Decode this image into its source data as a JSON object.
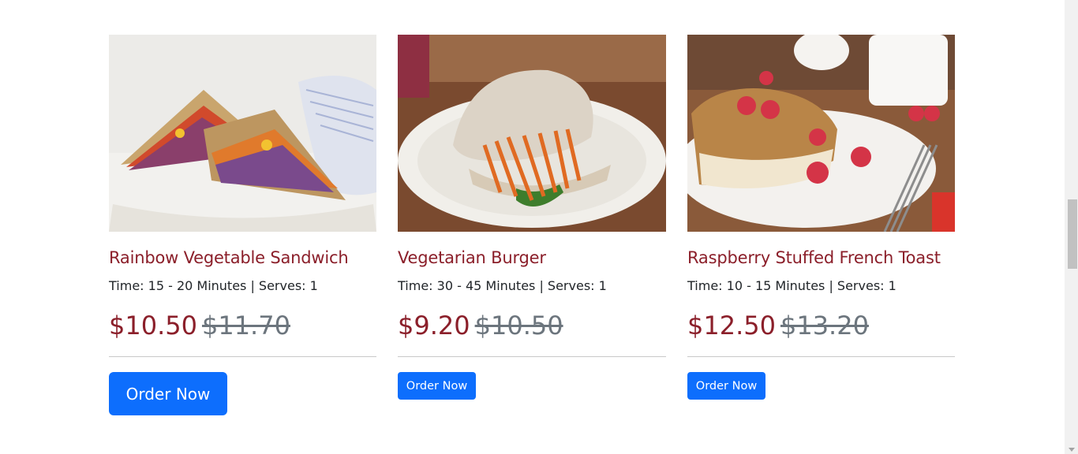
{
  "cards": [
    {
      "title": "Rainbow Vegetable Sandwich",
      "meta": "Time: 15 - 20 Minutes | Serves: 1",
      "price_now": "$10.50",
      "price_old": "$11.70",
      "button": "Order Now"
    },
    {
      "title": "Vegetarian Burger",
      "meta": "Time: 30 - 45 Minutes | Serves: 1",
      "price_now": "$9.20",
      "price_old": "$10.50",
      "button": "Order Now"
    },
    {
      "title": "Raspberry Stuffed French Toast",
      "meta": "Time: 10 - 15 Minutes | Serves: 1",
      "price_now": "$12.50",
      "price_old": "$13.20",
      "button": "Order Now"
    }
  ],
  "colors": {
    "title": "#8b1f2a",
    "button": "#0d6efd",
    "old_price": "#6c757d"
  }
}
